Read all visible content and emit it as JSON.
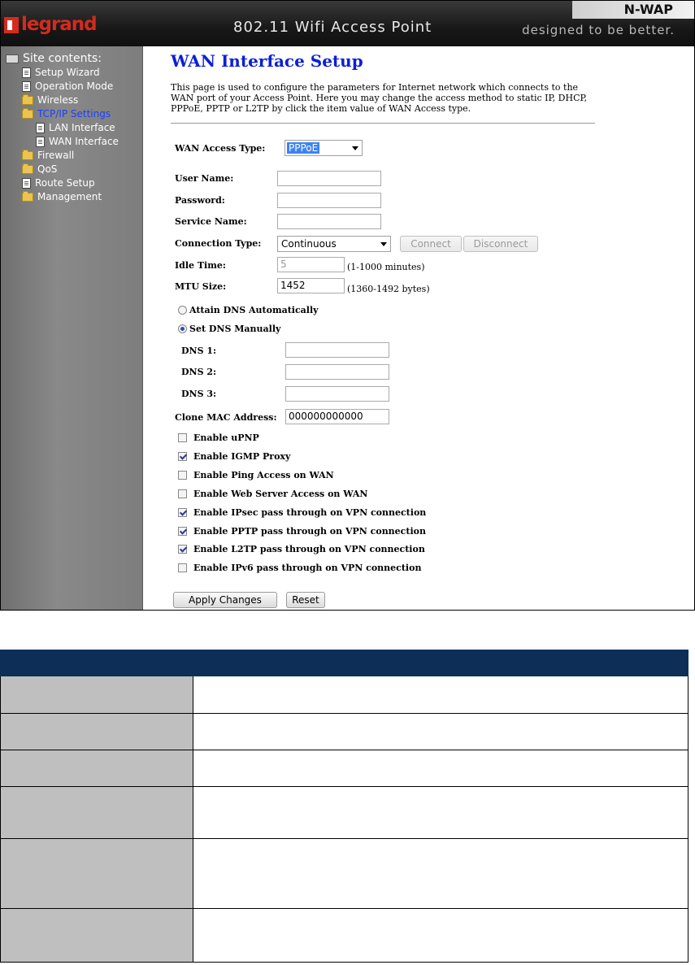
{
  "banner": {
    "brand": "legrand",
    "title": "802.11 Wifi Access Point",
    "badge": "N-WAP",
    "tagline": "designed to be better."
  },
  "sidebar": {
    "root_label": "Site contents:",
    "items": [
      {
        "label": "Setup Wizard",
        "icon": "page-icon"
      },
      {
        "label": "Operation Mode",
        "icon": "page-icon"
      },
      {
        "label": "Wireless",
        "icon": "folder-icon"
      },
      {
        "label": "TCP/IP Settings",
        "icon": "open-folder-icon",
        "active": true
      },
      {
        "label": "LAN Interface",
        "icon": "page-icon"
      },
      {
        "label": "WAN Interface",
        "icon": "page-icon"
      },
      {
        "label": "Firewall",
        "icon": "folder-icon"
      },
      {
        "label": "QoS",
        "icon": "folder-icon"
      },
      {
        "label": "Route Setup",
        "icon": "page-icon"
      },
      {
        "label": "Management",
        "icon": "folder-icon"
      }
    ]
  },
  "page": {
    "title": "WAN Interface Setup",
    "description": "This page is used to configure the parameters for Internet network which connects to the WAN port of your Access Point. Here you may change the access method to static IP, DHCP, PPPoE, PPTP or L2TP by click the item value of WAN Access type."
  },
  "form": {
    "wan_access_type": {
      "label": "WAN Access Type:",
      "value": "PPPoE"
    },
    "user_name": {
      "label": "User Name:",
      "value": ""
    },
    "password": {
      "label": "Password:",
      "value": ""
    },
    "service_name": {
      "label": "Service Name:",
      "value": ""
    },
    "connection_type": {
      "label": "Connection Type:",
      "value": "Continuous"
    },
    "connect_button": "Connect",
    "disconnect_button": "Disconnect",
    "idle_time": {
      "label": "Idle Time:",
      "value": "5",
      "hint": "(1-1000 minutes)"
    },
    "mtu_size": {
      "label": "MTU Size:",
      "value": "1452",
      "hint": "(1360-1492 bytes)"
    },
    "dns_auto": {
      "label": "Attain DNS Automatically",
      "checked": false
    },
    "dns_manual": {
      "label": "Set DNS Manually",
      "checked": true
    },
    "dns1": {
      "label": "DNS 1:",
      "value": ""
    },
    "dns2": {
      "label": "DNS 2:",
      "value": ""
    },
    "dns3": {
      "label": "DNS 3:",
      "value": ""
    },
    "clone_mac": {
      "label": "Clone MAC Address:",
      "value": "000000000000"
    },
    "options": [
      {
        "label": "Enable uPNP",
        "checked": false
      },
      {
        "label": "Enable IGMP Proxy",
        "checked": true
      },
      {
        "label": "Enable Ping Access on WAN",
        "checked": false
      },
      {
        "label": "Enable Web Server Access on WAN",
        "checked": false
      },
      {
        "label": "Enable IPsec pass through on VPN connection",
        "checked": true
      },
      {
        "label": "Enable PPTP pass through on VPN connection",
        "checked": true
      },
      {
        "label": "Enable L2TP pass through on VPN connection",
        "checked": true
      },
      {
        "label": "Enable IPv6 pass through on VPN connection",
        "checked": false
      }
    ],
    "apply_button": "Apply Changes",
    "reset_button": "Reset"
  },
  "colors": {
    "title_blue": "#0c1fd6",
    "selected_blue": "#3b82f6",
    "table_header": "#0d2f57",
    "table_label_cell": "#bfbfbf"
  }
}
